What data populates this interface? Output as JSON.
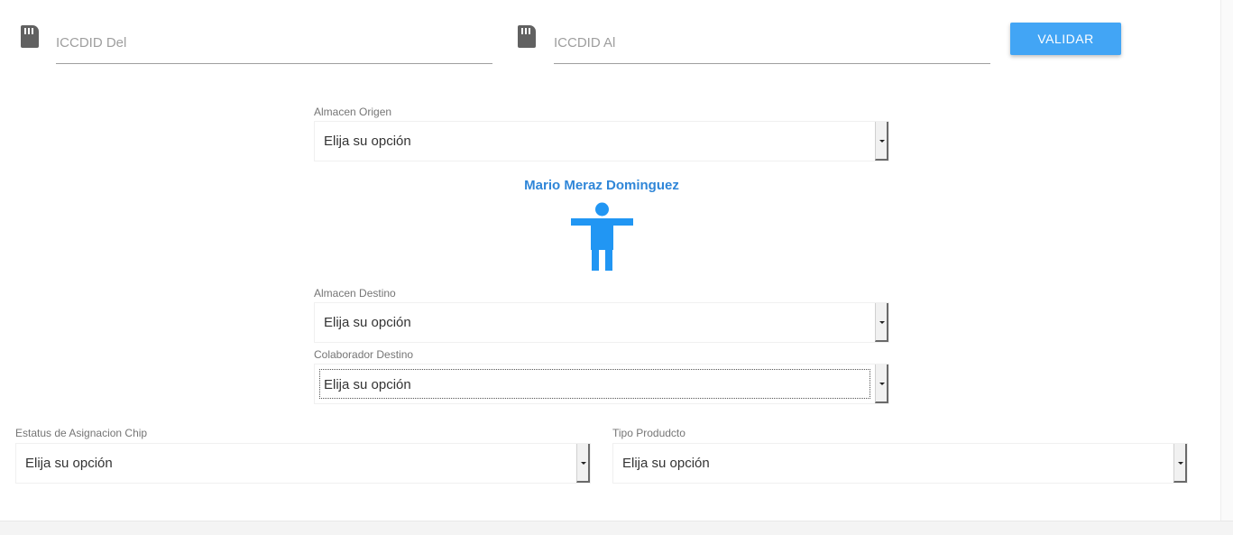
{
  "iccid_from": {
    "placeholder": "ICCDID Del",
    "icon": "sim-card-icon"
  },
  "iccid_to": {
    "placeholder": "ICCDID Al",
    "icon": "sim-card-icon"
  },
  "validate_button": {
    "label": "VALIDAR"
  },
  "almacen_origen": {
    "label": "Almacen Origen",
    "value": "Elija su opción"
  },
  "user": {
    "name": "Mario Meraz Dominguez",
    "icon": "person-icon"
  },
  "almacen_destino": {
    "label": "Almacen Destino",
    "value": "Elija su opción"
  },
  "colaborador_destino": {
    "label": "Colaborador Destino",
    "value": "Elija su opción"
  },
  "estatus_asignacion": {
    "label": "Estatus de Asignacion Chip",
    "value": "Elija su opción"
  },
  "tipo_producto": {
    "label": "Tipo Produdcto",
    "value": "Elija su opción"
  },
  "colors": {
    "accent": "#42a5f5",
    "user_name": "#2f86d8",
    "person_icon": "#2196f3",
    "icon_gray": "#616161"
  }
}
